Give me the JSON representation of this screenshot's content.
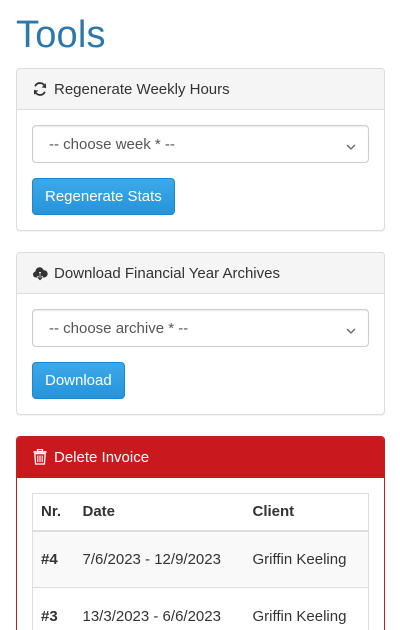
{
  "page": {
    "title": "Tools"
  },
  "regenerate": {
    "heading": "Regenerate Weekly Hours",
    "icon": "refresh-icon",
    "select_value": "-- choose week * --",
    "button_label": "Regenerate Stats"
  },
  "download": {
    "heading": "Download Financial Year Archives",
    "icon": "cloud-download-icon",
    "select_value": "-- choose archive * --",
    "button_label": "Download"
  },
  "delete_invoice": {
    "heading": "Delete Invoice",
    "icon": "trash-icon",
    "columns": {
      "nr": "Nr.",
      "date": "Date",
      "client": "Client"
    },
    "rows": [
      {
        "nr": "#4",
        "date": "7/6/2023 - 12/9/2023",
        "client": "Griffin Keeling"
      },
      {
        "nr": "#3",
        "date": "13/3/2023 - 6/6/2023",
        "client": "Griffin Keeling"
      }
    ]
  },
  "colors": {
    "title": "#2f77a8",
    "primary_button": "#2494dc",
    "danger_header": "#c9191e"
  }
}
